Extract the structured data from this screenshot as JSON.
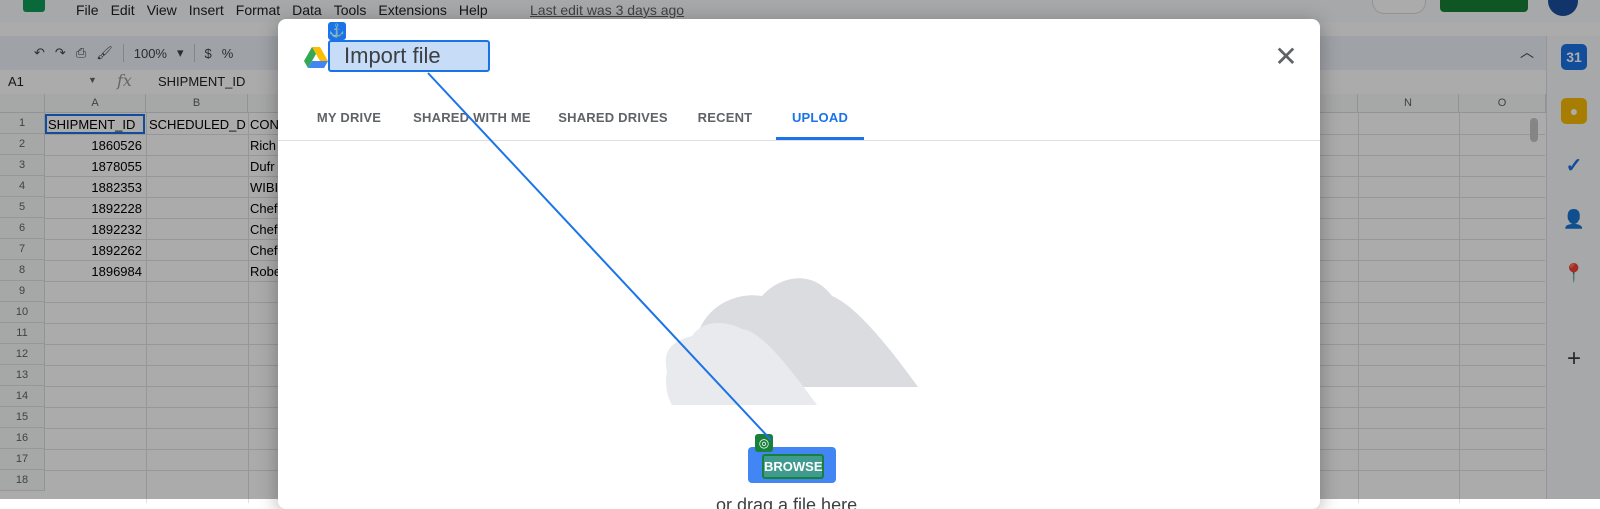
{
  "menubar": {
    "items": [
      "File",
      "Edit",
      "View",
      "Insert",
      "Format",
      "Data",
      "Tools",
      "Extensions",
      "Help"
    ],
    "last_edit": "Last edit was 3 days ago"
  },
  "toolbar": {
    "zoom": "100%",
    "currency": "$",
    "percent": "%"
  },
  "formula_bar": {
    "cell_ref": "A1",
    "fx": "fx",
    "content": "SHIPMENT_ID"
  },
  "grid": {
    "columns": [
      "A",
      "B",
      "N",
      "O"
    ],
    "rows": [
      "1",
      "2",
      "3",
      "4",
      "5",
      "6",
      "7",
      "8",
      "9",
      "10",
      "11",
      "12",
      "13",
      "14",
      "15",
      "16",
      "17",
      "18"
    ],
    "header_row": [
      "SHIPMENT_ID",
      "SCHEDULED_D",
      "CON"
    ],
    "data": [
      [
        "1860526",
        "Rich"
      ],
      [
        "1878055",
        "Dufr"
      ],
      [
        "1882353",
        "WIBI"
      ],
      [
        "1892228",
        "Chef"
      ],
      [
        "1892232",
        "Chef"
      ],
      [
        "1892262",
        "Chef"
      ],
      [
        "1896984",
        "Robe"
      ]
    ]
  },
  "dialog": {
    "title": "Import file",
    "tabs": [
      {
        "label": "MY DRIVE"
      },
      {
        "label": "SHARED WITH ME"
      },
      {
        "label": "SHARED DRIVES"
      },
      {
        "label": "RECENT"
      },
      {
        "label": "UPLOAD",
        "active": true
      }
    ],
    "browse_label": "BROWSE",
    "drag_hint": "or drag a file here"
  },
  "icons": {
    "close": "close-icon",
    "drive": "google-drive-icon",
    "anchor": "anchor-icon",
    "target": "target-icon",
    "cloud": "upload-cloud-illustration"
  },
  "colors": {
    "accent": "#1a73e8",
    "browse_bg": "#4285f4",
    "target_green": "#188038"
  }
}
